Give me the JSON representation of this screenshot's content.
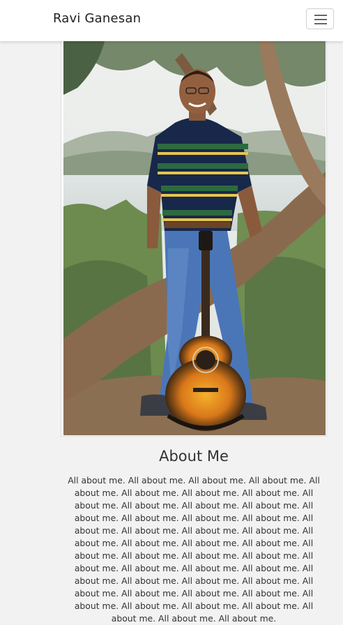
{
  "navbar": {
    "brand": "Ravi Ganesan",
    "menu_icon": "hamburger-menu-icon"
  },
  "hero": {
    "photo_subject": "portrait-photo"
  },
  "about": {
    "title": "About Me",
    "body": "All about me.  All about me. All about me. All about me. All about me. All about me. All about me. All about me. All about me. All about me. All about me. All about me. All about me. All about me. All about me. All about me. All about me. All about me. All about me. All about me. All about me. All about me. All about me. All about me. All about me. All about me. All about me. All about me. All about me. All about me. All about me. All about me. All about me. All about me. All about me. All about me. All about me. All about me. All about me. All about me. All about me. All about me. All about me. All about me. All about me. All about me. All about me."
  }
}
